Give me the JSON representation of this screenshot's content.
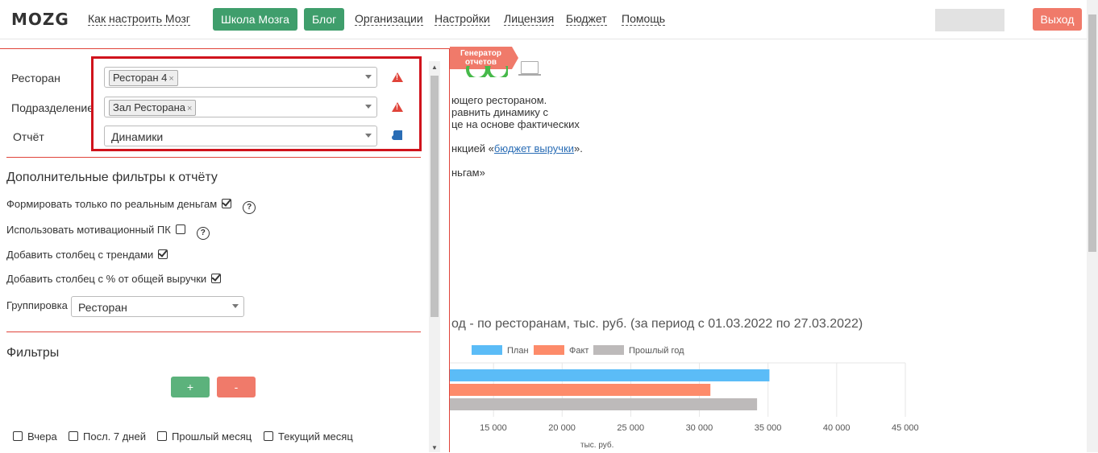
{
  "nav": {
    "logo": "MOZG",
    "how_to": "Как настроить Мозг",
    "school": "Школа Мозга",
    "blog": "Блог",
    "orgs": "Организации",
    "settings": "Настройки",
    "license": "Лицензия",
    "budget": "Бюджет",
    "help": "Помощь",
    "logout": "Выход"
  },
  "form": {
    "restaurant_label": "Ресторан",
    "restaurant_tag": "Ресторан 4",
    "division_label": "Подразделение",
    "division_tag": "Зал Ресторана",
    "report_label": "Отчёт",
    "report_value": "Динамики",
    "tag_remove": "×"
  },
  "extra_filters": {
    "title": "Дополнительные фильтры к отчёту",
    "real_money": "Формировать только по реальным деньгам",
    "real_money_checked": true,
    "motivational_pk": "Использовать мотивационный ПК",
    "motivational_pk_checked": false,
    "trends": "Добавить столбец с трендами",
    "trends_checked": true,
    "percent_revenue": "Добавить столбец с % от общей выручки",
    "percent_revenue_checked": true,
    "grouping_label": "Группировка",
    "grouping_value": "Ресторан"
  },
  "filters": {
    "title": "Фильтры",
    "plus": "+",
    "minus": "-",
    "periods": [
      "Вчера",
      "Посл. 7 дней",
      "Прошлый месяц",
      "Текущий месяц"
    ]
  },
  "report": {
    "ribbon_line1": "Генератор",
    "ribbon_line2": "отчетов",
    "desc1": "ющего рестораном.",
    "desc2": "равнить динамику с",
    "desc3": "це на основе фактических",
    "desc4_prefix": "нкцией «",
    "desc4_link": "бюджет выручки",
    "desc4_suffix": "».",
    "desc5": "ньгам»"
  },
  "chart_data": {
    "type": "bar",
    "orientation": "horizontal",
    "title": "од - по ресторанам, тыс. руб. (за период с 01.03.2022 по 27.03.2022)",
    "xlabel": "тыс. руб.",
    "x_ticks": [
      "15 000",
      "20 000",
      "25 000",
      "30 000",
      "35 000",
      "40 000",
      "45 000"
    ],
    "xlim": [
      10000,
      45000
    ],
    "grid": true,
    "legend_position": "top",
    "series": [
      {
        "name": "План",
        "color": "#5bbcf7",
        "values": [
          35100
        ]
      },
      {
        "name": "Факт",
        "color": "#fd8b6a",
        "values": [
          30800
        ]
      },
      {
        "name": "Прошлый год",
        "color": "#bdbaba",
        "values": [
          34200
        ]
      }
    ]
  }
}
